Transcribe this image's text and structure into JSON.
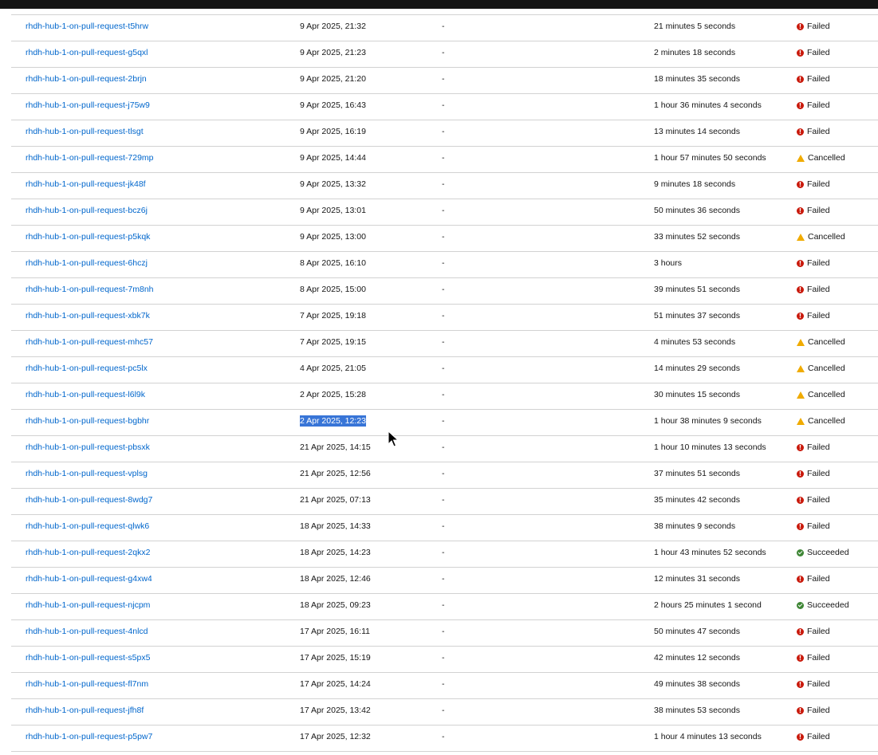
{
  "rows": [
    {
      "name": "rhdh-hub-1-on-pull-request-t5hrw",
      "started": "9 Apr 2025, 21:32",
      "task_status": "-",
      "duration": "21 minutes 5 seconds",
      "status": "Failed"
    },
    {
      "name": "rhdh-hub-1-on-pull-request-g5qxl",
      "started": "9 Apr 2025, 21:23",
      "task_status": "-",
      "duration": "2 minutes 18 seconds",
      "status": "Failed"
    },
    {
      "name": "rhdh-hub-1-on-pull-request-2brjn",
      "started": "9 Apr 2025, 21:20",
      "task_status": "-",
      "duration": "18 minutes 35 seconds",
      "status": "Failed"
    },
    {
      "name": "rhdh-hub-1-on-pull-request-j75w9",
      "started": "9 Apr 2025, 16:43",
      "task_status": "-",
      "duration": "1 hour 36 minutes 4 seconds",
      "status": "Failed"
    },
    {
      "name": "rhdh-hub-1-on-pull-request-tlsgt",
      "started": "9 Apr 2025, 16:19",
      "task_status": "-",
      "duration": "13 minutes 14 seconds",
      "status": "Failed"
    },
    {
      "name": "rhdh-hub-1-on-pull-request-729mp",
      "started": "9 Apr 2025, 14:44",
      "task_status": "-",
      "duration": "1 hour 57 minutes 50 seconds",
      "status": "Cancelled"
    },
    {
      "name": "rhdh-hub-1-on-pull-request-jk48f",
      "started": "9 Apr 2025, 13:32",
      "task_status": "-",
      "duration": "9 minutes 18 seconds",
      "status": "Failed"
    },
    {
      "name": "rhdh-hub-1-on-pull-request-bcz6j",
      "started": "9 Apr 2025, 13:01",
      "task_status": "-",
      "duration": "50 minutes 36 seconds",
      "status": "Failed"
    },
    {
      "name": "rhdh-hub-1-on-pull-request-p5kqk",
      "started": "9 Apr 2025, 13:00",
      "task_status": "-",
      "duration": "33 minutes 52 seconds",
      "status": "Cancelled"
    },
    {
      "name": "rhdh-hub-1-on-pull-request-6hczj",
      "started": "8 Apr 2025, 16:10",
      "task_status": "-",
      "duration": "3 hours",
      "status": "Failed"
    },
    {
      "name": "rhdh-hub-1-on-pull-request-7m8nh",
      "started": "8 Apr 2025, 15:00",
      "task_status": "-",
      "duration": "39 minutes 51 seconds",
      "status": "Failed"
    },
    {
      "name": "rhdh-hub-1-on-pull-request-xbk7k",
      "started": "7 Apr 2025, 19:18",
      "task_status": "-",
      "duration": "51 minutes 37 seconds",
      "status": "Failed"
    },
    {
      "name": "rhdh-hub-1-on-pull-request-mhc57",
      "started": "7 Apr 2025, 19:15",
      "task_status": "-",
      "duration": "4 minutes 53 seconds",
      "status": "Cancelled"
    },
    {
      "name": "rhdh-hub-1-on-pull-request-pc5lx",
      "started": "4 Apr 2025, 21:05",
      "task_status": "-",
      "duration": "14 minutes 29 seconds",
      "status": "Cancelled"
    },
    {
      "name": "rhdh-hub-1-on-pull-request-l6l9k",
      "started": "2 Apr 2025, 15:28",
      "task_status": "-",
      "duration": "30 minutes 15 seconds",
      "status": "Cancelled"
    },
    {
      "name": "rhdh-hub-1-on-pull-request-bgbhr",
      "started": "2 Apr 2025, 12:23",
      "task_status": "-",
      "duration": "1 hour 38 minutes 9 seconds",
      "status": "Cancelled",
      "selected": true
    },
    {
      "name": "rhdh-hub-1-on-pull-request-pbsxk",
      "started": "21 Apr 2025, 14:15",
      "task_status": "-",
      "duration": "1 hour 10 minutes 13 seconds",
      "status": "Failed"
    },
    {
      "name": "rhdh-hub-1-on-pull-request-vplsg",
      "started": "21 Apr 2025, 12:56",
      "task_status": "-",
      "duration": "37 minutes 51 seconds",
      "status": "Failed"
    },
    {
      "name": "rhdh-hub-1-on-pull-request-8wdg7",
      "started": "21 Apr 2025, 07:13",
      "task_status": "-",
      "duration": "35 minutes 42 seconds",
      "status": "Failed"
    },
    {
      "name": "rhdh-hub-1-on-pull-request-qlwk6",
      "started": "18 Apr 2025, 14:33",
      "task_status": "-",
      "duration": "38 minutes 9 seconds",
      "status": "Failed"
    },
    {
      "name": "rhdh-hub-1-on-pull-request-2qkx2",
      "started": "18 Apr 2025, 14:23",
      "task_status": "-",
      "duration": "1 hour 43 minutes 52 seconds",
      "status": "Succeeded"
    },
    {
      "name": "rhdh-hub-1-on-pull-request-g4xw4",
      "started": "18 Apr 2025, 12:46",
      "task_status": "-",
      "duration": "12 minutes 31 seconds",
      "status": "Failed"
    },
    {
      "name": "rhdh-hub-1-on-pull-request-njcpm",
      "started": "18 Apr 2025, 09:23",
      "task_status": "-",
      "duration": "2 hours 25 minutes 1 second",
      "status": "Succeeded"
    },
    {
      "name": "rhdh-hub-1-on-pull-request-4nlcd",
      "started": "17 Apr 2025, 16:11",
      "task_status": "-",
      "duration": "50 minutes 47 seconds",
      "status": "Failed"
    },
    {
      "name": "rhdh-hub-1-on-pull-request-s5px5",
      "started": "17 Apr 2025, 15:19",
      "task_status": "-",
      "duration": "42 minutes 12 seconds",
      "status": "Failed"
    },
    {
      "name": "rhdh-hub-1-on-pull-request-fl7nm",
      "started": "17 Apr 2025, 14:24",
      "task_status": "-",
      "duration": "49 minutes 38 seconds",
      "status": "Failed"
    },
    {
      "name": "rhdh-hub-1-on-pull-request-jfh8f",
      "started": "17 Apr 2025, 13:42",
      "task_status": "-",
      "duration": "38 minutes 53 seconds",
      "status": "Failed"
    },
    {
      "name": "rhdh-hub-1-on-pull-request-p5pw7",
      "started": "17 Apr 2025, 12:32",
      "task_status": "-",
      "duration": "1 hour 4 minutes 13 seconds",
      "status": "Failed"
    }
  ],
  "status_colors": {
    "Failed": "#c9190b",
    "Cancelled": "#f0ab00",
    "Succeeded": "#3e8635"
  },
  "status_icons": {
    "Failed": "exclamation-circle-icon",
    "Cancelled": "warning-triangle-icon",
    "Succeeded": "check-circle-icon"
  },
  "link_color": "#0066cc",
  "selection_color": "#3875d7"
}
